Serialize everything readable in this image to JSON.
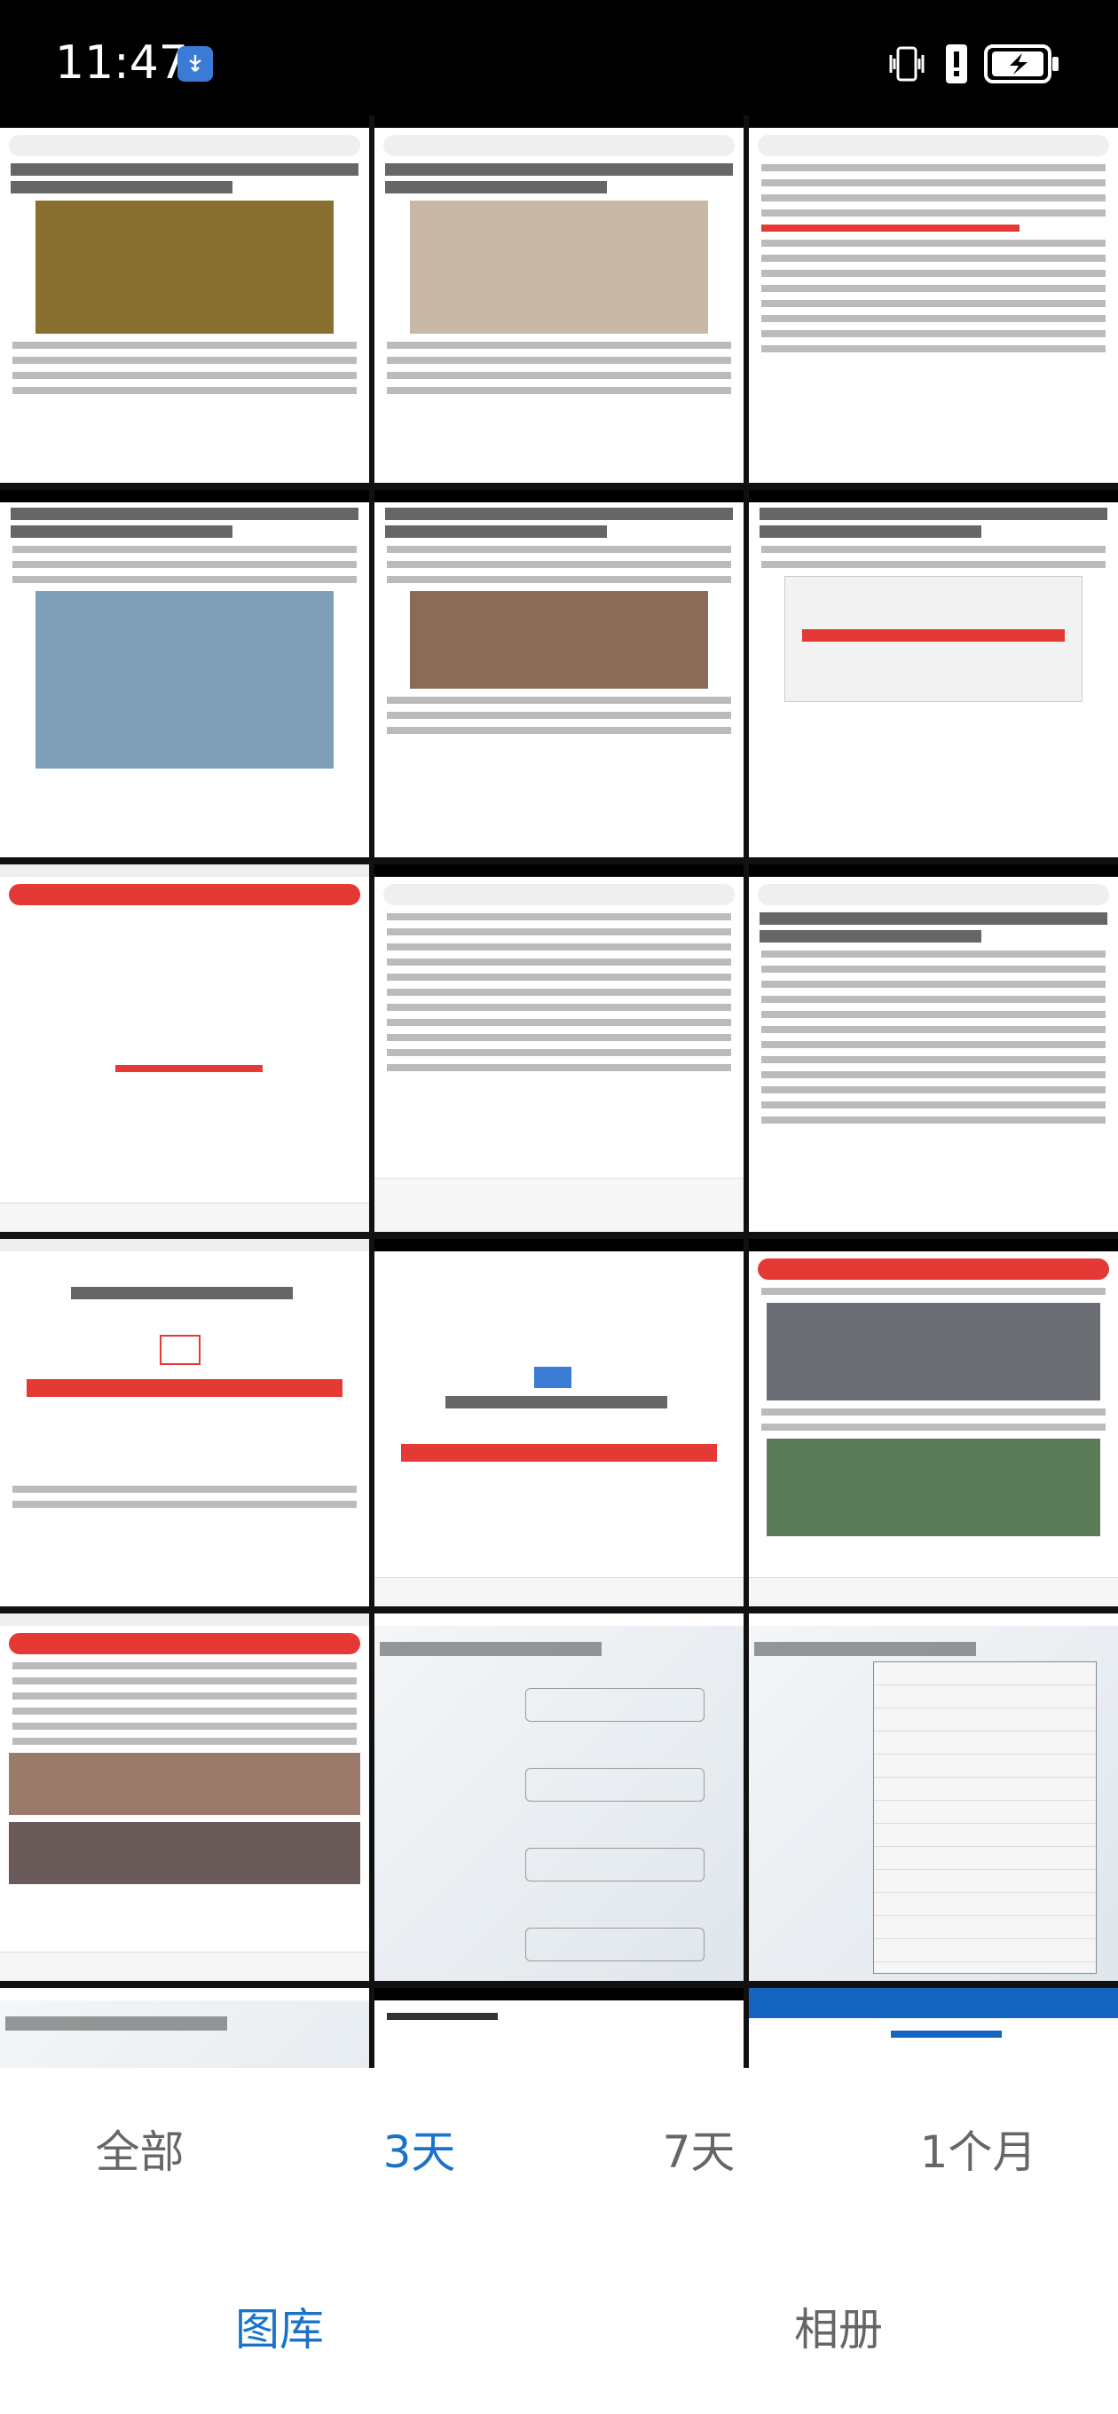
{
  "status_bar": {
    "time": "11:47",
    "icons": [
      "usb-icon",
      "vibrate-icon",
      "alert-icon",
      "battery-charging-icon"
    ],
    "usb_badge_color": "#3a7bd5"
  },
  "grid": {
    "thumbnail_count": 18,
    "description_type": "screenshot-thumbnails"
  },
  "time_tabs": [
    {
      "label": "全部",
      "active": false
    },
    {
      "label": "3天",
      "active": true
    },
    {
      "label": "7天",
      "active": false
    },
    {
      "label": "1个月",
      "active": false
    }
  ],
  "bottom_nav": [
    {
      "label": "图库",
      "active": true
    },
    {
      "label": "相册",
      "active": false
    }
  ],
  "colors": {
    "accent": "#1a73c8",
    "inactive_text": "#666666",
    "status_bar_bg": "#000000"
  }
}
